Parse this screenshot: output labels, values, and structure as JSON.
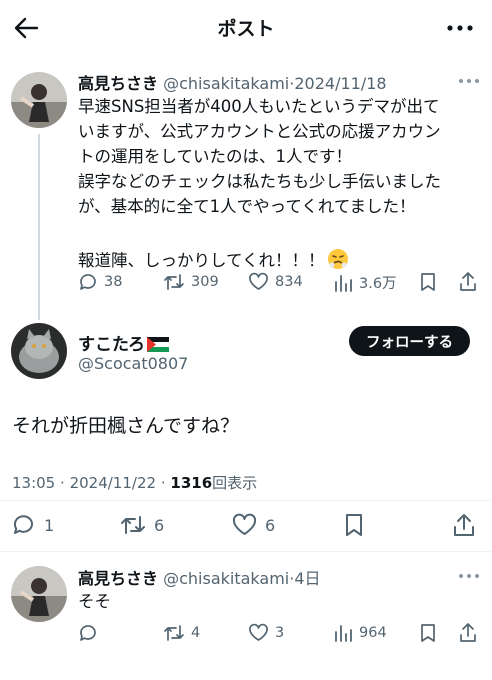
{
  "header": {
    "title": "ポスト",
    "back_icon": "arrow-left-icon",
    "more_icon": "more-horizontal-icon"
  },
  "reply_to": {
    "name": "高見ちさき",
    "handle": "@chisakitakami",
    "date": "2024/11/18",
    "lines": [
      "早速SNS担当者が400人もいたというデマが出て",
      "いますが、公式アカウントと公式の応援アカウン",
      "トの運用をしていたのは、1人です！",
      "誤字などのチェックは私たちも少し手伝いました",
      "が、基本的に全て1人でやってくれてました！",
      "",
      "報道陣、しっかりしてくれ！！！"
    ],
    "emoji": "😤",
    "stats": {
      "replies": "38",
      "reposts": "309",
      "likes": "834",
      "views": "3.6万"
    }
  },
  "main_post": {
    "name": "すこたろ",
    "handle": "@Scocat0807",
    "follow_label": "フォローする",
    "text": "それが折田楓さんですね？",
    "time": "13:05",
    "date": "2024/11/22",
    "view_count": "1316",
    "view_label": "回表示",
    "stats": {
      "replies": "1",
      "reposts": "6",
      "likes": "6"
    }
  },
  "reply": {
    "name": "高見ちさき",
    "handle": "@chisakitakami",
    "date": "4日",
    "text": "そそ",
    "stats": {
      "reposts": "4",
      "likes": "3",
      "views": "964"
    }
  },
  "colors": {
    "text": "#0f1419",
    "muted": "#536471",
    "line": "#cfd9de",
    "flag_green": "#149954",
    "flag_red": "#e4312b"
  }
}
